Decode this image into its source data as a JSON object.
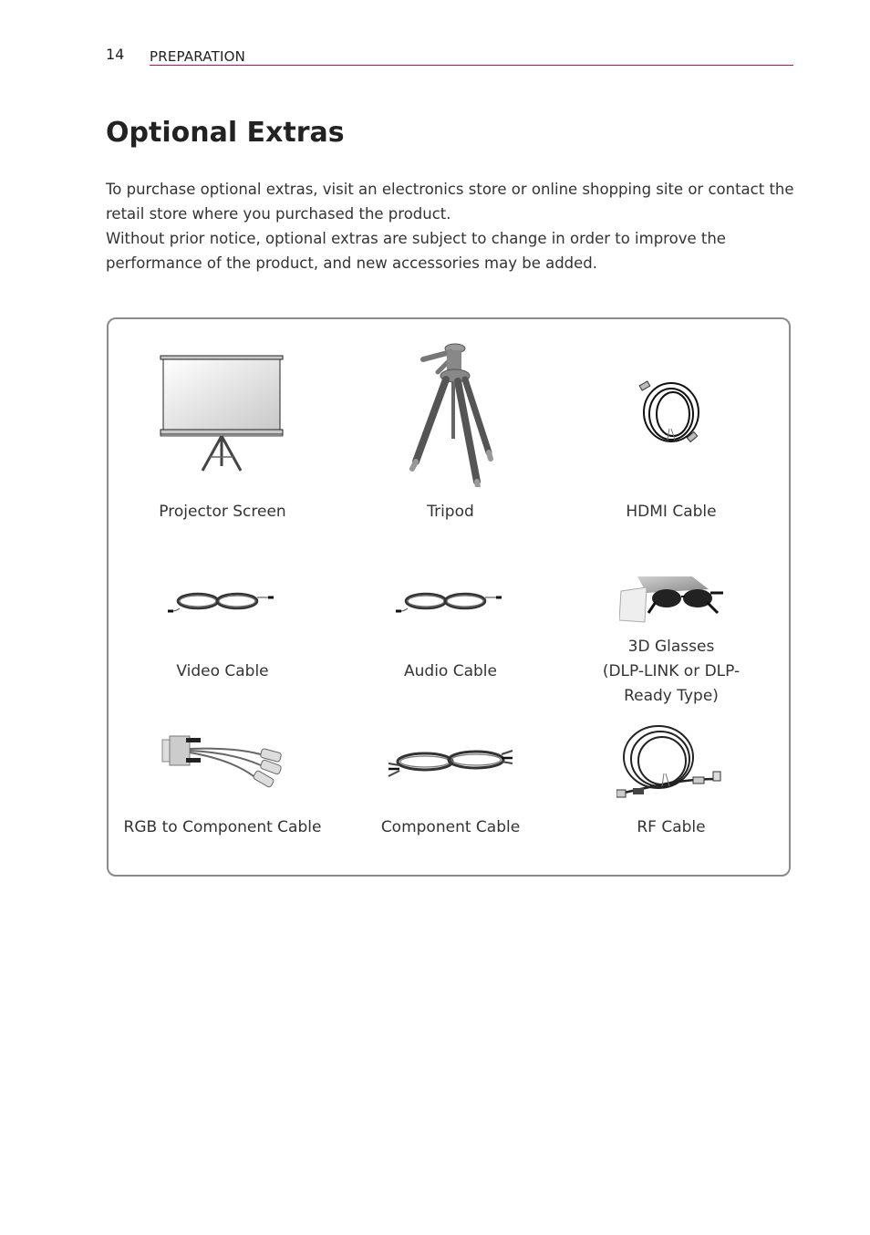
{
  "header": {
    "page_number": "14",
    "section": "PREPARATION",
    "accent_color": "#b5115f"
  },
  "title": "Optional Extras",
  "intro": {
    "paragraph1": "To purchase optional extras, visit an electronics store or online shopping site or contact the retail store where you purchased the product.",
    "paragraph2": "Without prior notice, optional extras are subject to change in order to improve the performance of the product, and new accessories may be added."
  },
  "extras": [
    {
      "label": "Projector Screen",
      "icon": "projector-screen-icon"
    },
    {
      "label": "Tripod",
      "icon": "tripod-icon"
    },
    {
      "label": "HDMI Cable",
      "icon": "hdmi-cable-icon"
    },
    {
      "label": "Video Cable",
      "icon": "video-cable-icon"
    },
    {
      "label": "Audio Cable",
      "icon": "audio-cable-icon"
    },
    {
      "label": "3D Glasses",
      "label_line2": "(DLP-LINK or DLP-",
      "label_line3": "Ready Type)",
      "icon": "3d-glasses-icon"
    },
    {
      "label": "RGB to Component Cable",
      "icon": "rgb-component-cable-icon"
    },
    {
      "label": "Component Cable",
      "icon": "component-cable-icon"
    },
    {
      "label": "RF Cable",
      "icon": "rf-cable-icon"
    }
  ]
}
